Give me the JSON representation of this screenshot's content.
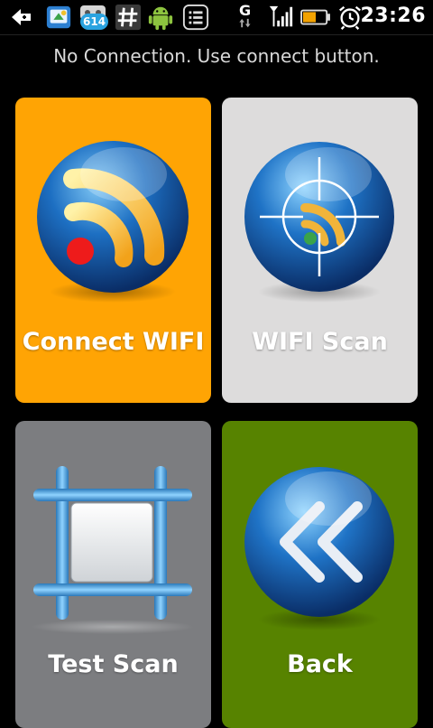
{
  "status_bar": {
    "notification_badge": "614",
    "network_type": "G",
    "time": "23:26",
    "icons": [
      "back-arrow-icon",
      "app-update-icon",
      "notification-app-icon",
      "hash-icon",
      "android-icon",
      "list-icon",
      "network-g-icon",
      "signal-icon",
      "battery-icon",
      "alarm-icon"
    ]
  },
  "message": "No Connection. Use connect button.",
  "tiles": [
    {
      "label": "Connect WIFI",
      "color": "#ffa404",
      "icon": "rss-wifi-icon"
    },
    {
      "label": "WIFI Scan",
      "color": "#dddcdc",
      "icon": "crosshair-wifi-icon"
    },
    {
      "label": "Test Scan",
      "color": "#7c7d80",
      "icon": "frame-icon"
    },
    {
      "label": "Back",
      "color": "#578300",
      "icon": "double-chevron-left-icon"
    }
  ]
}
